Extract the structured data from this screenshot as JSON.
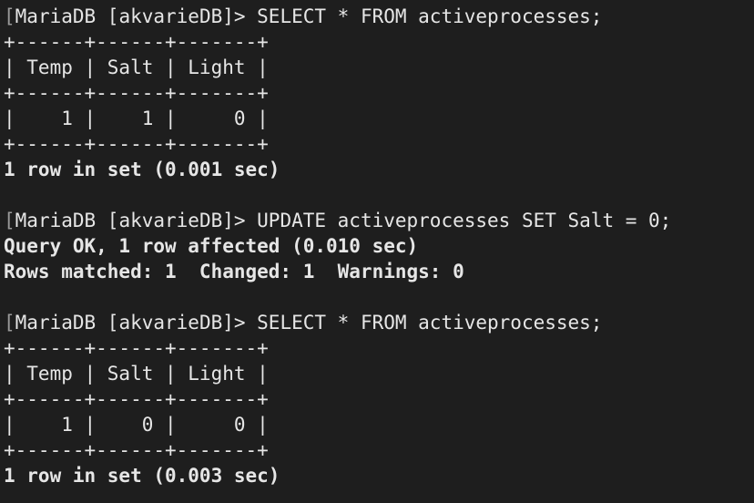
{
  "terminal": {
    "lines": [
      {
        "text": "MariaDB [akvarieDB]> SELECT * FROM activeprocesses;",
        "bold": false,
        "bracket": true
      },
      {
        "text": "+------+------+-------+",
        "bold": false,
        "bracket": false
      },
      {
        "text": "| Temp | Salt | Light |",
        "bold": false,
        "bracket": false
      },
      {
        "text": "+------+------+-------+",
        "bold": false,
        "bracket": false
      },
      {
        "text": "|    1 |    1 |     0 |",
        "bold": false,
        "bracket": false
      },
      {
        "text": "+------+------+-------+",
        "bold": false,
        "bracket": false
      },
      {
        "text": "1 row in set (0.001 sec)",
        "bold": true,
        "bracket": false
      },
      {
        "text": "",
        "bold": false,
        "bracket": false
      },
      {
        "text": "MariaDB [akvarieDB]> UPDATE activeprocesses SET Salt = 0;",
        "bold": false,
        "bracket": true
      },
      {
        "text": "Query OK, 1 row affected (0.010 sec)",
        "bold": true,
        "bracket": false
      },
      {
        "text": "Rows matched: 1  Changed: 1  Warnings: 0",
        "bold": true,
        "bracket": false
      },
      {
        "text": "",
        "bold": false,
        "bracket": false
      },
      {
        "text": "MariaDB [akvarieDB]> SELECT * FROM activeprocesses;",
        "bold": false,
        "bracket": true
      },
      {
        "text": "+------+------+-------+",
        "bold": false,
        "bracket": false
      },
      {
        "text": "| Temp | Salt | Light |",
        "bold": false,
        "bracket": false
      },
      {
        "text": "+------+------+-------+",
        "bold": false,
        "bracket": false
      },
      {
        "text": "|    1 |    0 |     0 |",
        "bold": false,
        "bracket": false
      },
      {
        "text": "+------+------+-------+",
        "bold": false,
        "bracket": false
      },
      {
        "text": "1 row in set (0.003 sec)",
        "bold": true,
        "bracket": false
      }
    ]
  },
  "colors": {
    "background": "#1e1e1e",
    "foreground": "#e6e6e6"
  }
}
